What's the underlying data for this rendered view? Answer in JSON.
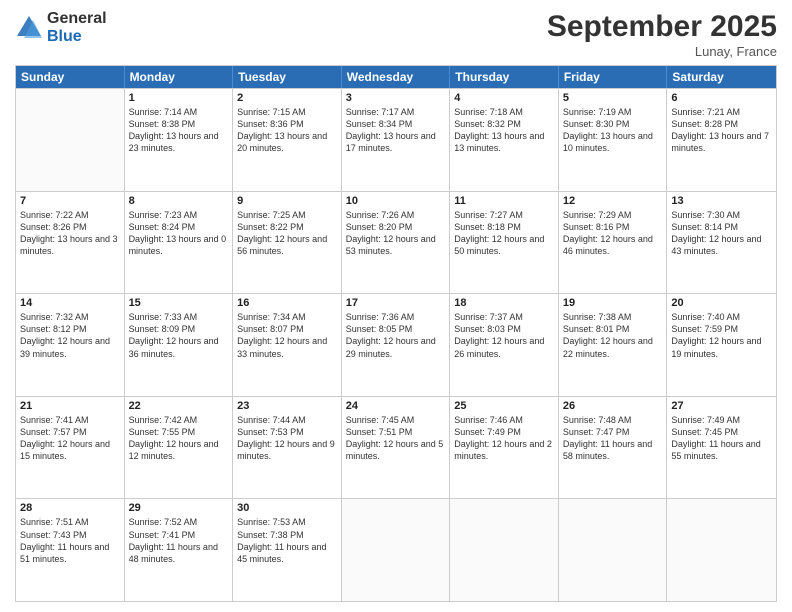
{
  "logo": {
    "general": "General",
    "blue": "Blue"
  },
  "title": {
    "month": "September 2025",
    "location": "Lunay, France"
  },
  "calendar": {
    "headers": [
      "Sunday",
      "Monday",
      "Tuesday",
      "Wednesday",
      "Thursday",
      "Friday",
      "Saturday"
    ],
    "weeks": [
      [
        {
          "date": "",
          "sunrise": "",
          "sunset": "",
          "daylight": ""
        },
        {
          "date": "1",
          "sunrise": "Sunrise: 7:14 AM",
          "sunset": "Sunset: 8:38 PM",
          "daylight": "Daylight: 13 hours and 23 minutes."
        },
        {
          "date": "2",
          "sunrise": "Sunrise: 7:15 AM",
          "sunset": "Sunset: 8:36 PM",
          "daylight": "Daylight: 13 hours and 20 minutes."
        },
        {
          "date": "3",
          "sunrise": "Sunrise: 7:17 AM",
          "sunset": "Sunset: 8:34 PM",
          "daylight": "Daylight: 13 hours and 17 minutes."
        },
        {
          "date": "4",
          "sunrise": "Sunrise: 7:18 AM",
          "sunset": "Sunset: 8:32 PM",
          "daylight": "Daylight: 13 hours and 13 minutes."
        },
        {
          "date": "5",
          "sunrise": "Sunrise: 7:19 AM",
          "sunset": "Sunset: 8:30 PM",
          "daylight": "Daylight: 13 hours and 10 minutes."
        },
        {
          "date": "6",
          "sunrise": "Sunrise: 7:21 AM",
          "sunset": "Sunset: 8:28 PM",
          "daylight": "Daylight: 13 hours and 7 minutes."
        }
      ],
      [
        {
          "date": "7",
          "sunrise": "Sunrise: 7:22 AM",
          "sunset": "Sunset: 8:26 PM",
          "daylight": "Daylight: 13 hours and 3 minutes."
        },
        {
          "date": "8",
          "sunrise": "Sunrise: 7:23 AM",
          "sunset": "Sunset: 8:24 PM",
          "daylight": "Daylight: 13 hours and 0 minutes."
        },
        {
          "date": "9",
          "sunrise": "Sunrise: 7:25 AM",
          "sunset": "Sunset: 8:22 PM",
          "daylight": "Daylight: 12 hours and 56 minutes."
        },
        {
          "date": "10",
          "sunrise": "Sunrise: 7:26 AM",
          "sunset": "Sunset: 8:20 PM",
          "daylight": "Daylight: 12 hours and 53 minutes."
        },
        {
          "date": "11",
          "sunrise": "Sunrise: 7:27 AM",
          "sunset": "Sunset: 8:18 PM",
          "daylight": "Daylight: 12 hours and 50 minutes."
        },
        {
          "date": "12",
          "sunrise": "Sunrise: 7:29 AM",
          "sunset": "Sunset: 8:16 PM",
          "daylight": "Daylight: 12 hours and 46 minutes."
        },
        {
          "date": "13",
          "sunrise": "Sunrise: 7:30 AM",
          "sunset": "Sunset: 8:14 PM",
          "daylight": "Daylight: 12 hours and 43 minutes."
        }
      ],
      [
        {
          "date": "14",
          "sunrise": "Sunrise: 7:32 AM",
          "sunset": "Sunset: 8:12 PM",
          "daylight": "Daylight: 12 hours and 39 minutes."
        },
        {
          "date": "15",
          "sunrise": "Sunrise: 7:33 AM",
          "sunset": "Sunset: 8:09 PM",
          "daylight": "Daylight: 12 hours and 36 minutes."
        },
        {
          "date": "16",
          "sunrise": "Sunrise: 7:34 AM",
          "sunset": "Sunset: 8:07 PM",
          "daylight": "Daylight: 12 hours and 33 minutes."
        },
        {
          "date": "17",
          "sunrise": "Sunrise: 7:36 AM",
          "sunset": "Sunset: 8:05 PM",
          "daylight": "Daylight: 12 hours and 29 minutes."
        },
        {
          "date": "18",
          "sunrise": "Sunrise: 7:37 AM",
          "sunset": "Sunset: 8:03 PM",
          "daylight": "Daylight: 12 hours and 26 minutes."
        },
        {
          "date": "19",
          "sunrise": "Sunrise: 7:38 AM",
          "sunset": "Sunset: 8:01 PM",
          "daylight": "Daylight: 12 hours and 22 minutes."
        },
        {
          "date": "20",
          "sunrise": "Sunrise: 7:40 AM",
          "sunset": "Sunset: 7:59 PM",
          "daylight": "Daylight: 12 hours and 19 minutes."
        }
      ],
      [
        {
          "date": "21",
          "sunrise": "Sunrise: 7:41 AM",
          "sunset": "Sunset: 7:57 PM",
          "daylight": "Daylight: 12 hours and 15 minutes."
        },
        {
          "date": "22",
          "sunrise": "Sunrise: 7:42 AM",
          "sunset": "Sunset: 7:55 PM",
          "daylight": "Daylight: 12 hours and 12 minutes."
        },
        {
          "date": "23",
          "sunrise": "Sunrise: 7:44 AM",
          "sunset": "Sunset: 7:53 PM",
          "daylight": "Daylight: 12 hours and 9 minutes."
        },
        {
          "date": "24",
          "sunrise": "Sunrise: 7:45 AM",
          "sunset": "Sunset: 7:51 PM",
          "daylight": "Daylight: 12 hours and 5 minutes."
        },
        {
          "date": "25",
          "sunrise": "Sunrise: 7:46 AM",
          "sunset": "Sunset: 7:49 PM",
          "daylight": "Daylight: 12 hours and 2 minutes."
        },
        {
          "date": "26",
          "sunrise": "Sunrise: 7:48 AM",
          "sunset": "Sunset: 7:47 PM",
          "daylight": "Daylight: 11 hours and 58 minutes."
        },
        {
          "date": "27",
          "sunrise": "Sunrise: 7:49 AM",
          "sunset": "Sunset: 7:45 PM",
          "daylight": "Daylight: 11 hours and 55 minutes."
        }
      ],
      [
        {
          "date": "28",
          "sunrise": "Sunrise: 7:51 AM",
          "sunset": "Sunset: 7:43 PM",
          "daylight": "Daylight: 11 hours and 51 minutes."
        },
        {
          "date": "29",
          "sunrise": "Sunrise: 7:52 AM",
          "sunset": "Sunset: 7:41 PM",
          "daylight": "Daylight: 11 hours and 48 minutes."
        },
        {
          "date": "30",
          "sunrise": "Sunrise: 7:53 AM",
          "sunset": "Sunset: 7:38 PM",
          "daylight": "Daylight: 11 hours and 45 minutes."
        },
        {
          "date": "",
          "sunrise": "",
          "sunset": "",
          "daylight": ""
        },
        {
          "date": "",
          "sunrise": "",
          "sunset": "",
          "daylight": ""
        },
        {
          "date": "",
          "sunrise": "",
          "sunset": "",
          "daylight": ""
        },
        {
          "date": "",
          "sunrise": "",
          "sunset": "",
          "daylight": ""
        }
      ]
    ]
  }
}
